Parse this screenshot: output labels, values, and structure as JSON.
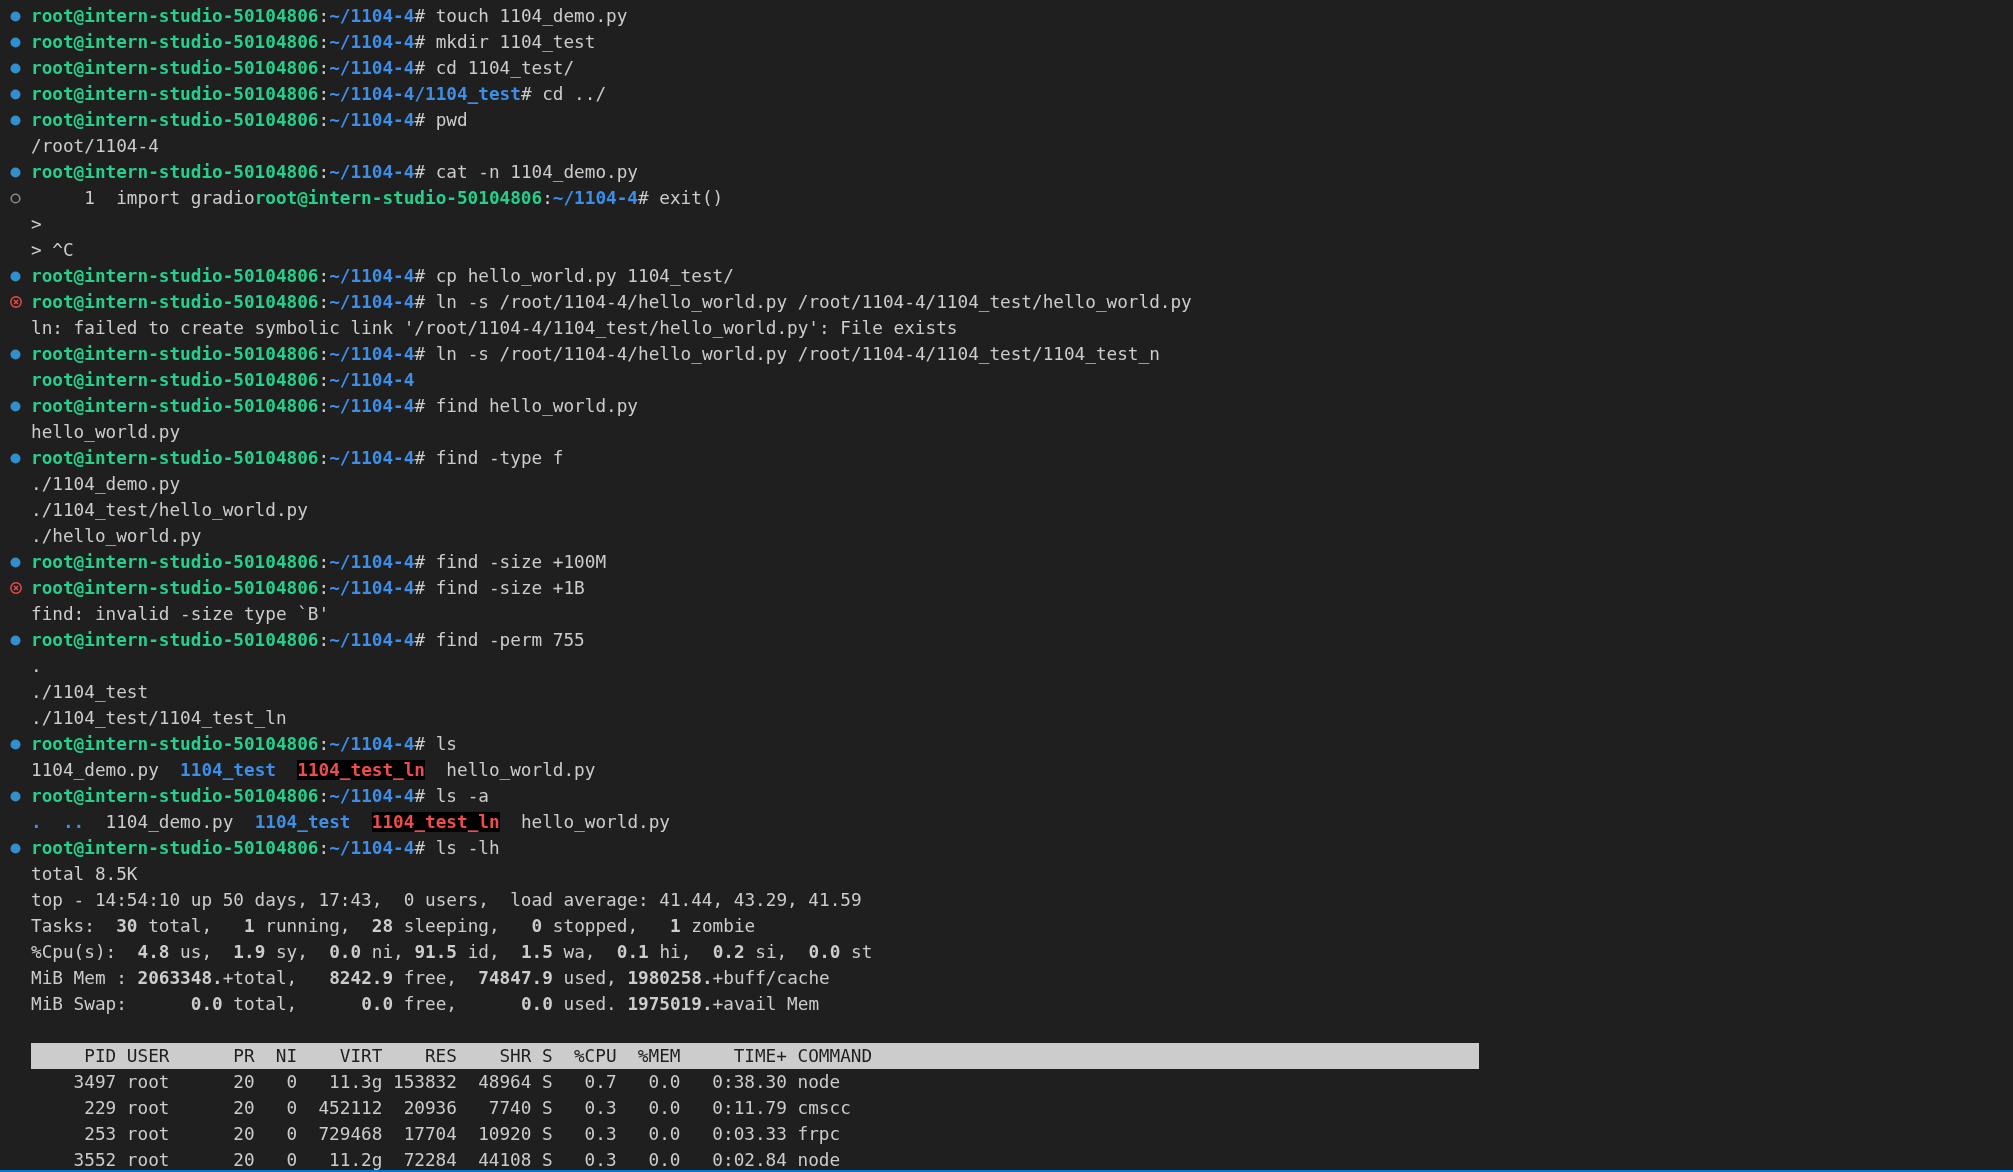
{
  "lines": [
    {
      "kind": "prompt_ok",
      "host": "root@intern-studio-50104806",
      "sep": ":",
      "path": "~/1104-4",
      "command": "# touch 1104_demo.py"
    },
    {
      "kind": "prompt_ok",
      "host": "root@intern-studio-50104806",
      "sep": ":",
      "path": "~/1104-4",
      "command": "# mkdir 1104_test"
    },
    {
      "kind": "prompt_ok",
      "host": "root@intern-studio-50104806",
      "sep": ":",
      "path": "~/1104-4",
      "command": "# cd 1104_test/"
    },
    {
      "kind": "prompt_ok",
      "host": "root@intern-studio-50104806",
      "sep": ":",
      "path": "~/1104-4/1104_test",
      "command": "# cd ../"
    },
    {
      "kind": "prompt_ok",
      "host": "root@intern-studio-50104806",
      "sep": ":",
      "path": "~/1104-4",
      "command": "# pwd"
    },
    {
      "kind": "output",
      "text": "/root/1104-4"
    },
    {
      "kind": "prompt_ok",
      "host": "root@intern-studio-50104806",
      "sep": ":",
      "path": "~/1104-4",
      "command": "# cat -n 1104_demo.py"
    },
    {
      "kind": "prompt_pending",
      "prefix": "     1  import gradio",
      "host": "root@intern-studio-50104806",
      "sep": ":",
      "path": "~/1104-4",
      "command": "# exit()"
    },
    {
      "kind": "output",
      "text": ">"
    },
    {
      "kind": "output",
      "text": "> ^C"
    },
    {
      "kind": "prompt_ok",
      "host": "root@intern-studio-50104806",
      "sep": ":",
      "path": "~/1104-4",
      "command": "# cp hello_world.py 1104_test/"
    },
    {
      "kind": "prompt_error",
      "host": "root@intern-studio-50104806",
      "sep": ":",
      "path": "~/1104-4",
      "command": "# ln -s /root/1104-4/hello_world.py /root/1104-4/1104_test/hello_world.py"
    },
    {
      "kind": "output",
      "text": "ln: failed to create symbolic link '/root/1104-4/1104_test/hello_world.py': File exists"
    },
    {
      "kind": "prompt_ok",
      "host": "root@intern-studio-50104806",
      "sep": ":",
      "path": "~/1104-4",
      "command": "# ln -s /root/1104-4/hello_world.py /root/1104-4/1104_test/1104_test_n"
    },
    {
      "kind": "prompt_plain",
      "host": "root@intern-studio-50104806",
      "sep": ":",
      "path": "~/1104-4"
    },
    {
      "kind": "prompt_ok",
      "host": "root@intern-studio-50104806",
      "sep": ":",
      "path": "~/1104-4",
      "command": "# find hello_world.py"
    },
    {
      "kind": "output",
      "text": "hello_world.py"
    },
    {
      "kind": "prompt_ok",
      "host": "root@intern-studio-50104806",
      "sep": ":",
      "path": "~/1104-4",
      "command": "# find -type f"
    },
    {
      "kind": "output",
      "text": "./1104_demo.py"
    },
    {
      "kind": "output",
      "text": "./1104_test/hello_world.py"
    },
    {
      "kind": "output",
      "text": "./hello_world.py"
    },
    {
      "kind": "prompt_ok",
      "host": "root@intern-studio-50104806",
      "sep": ":",
      "path": "~/1104-4",
      "command": "# find -size +100M"
    },
    {
      "kind": "prompt_error",
      "host": "root@intern-studio-50104806",
      "sep": ":",
      "path": "~/1104-4",
      "command": "# find -size +1B"
    },
    {
      "kind": "output",
      "text": "find: invalid -size type `B'"
    },
    {
      "kind": "prompt_ok",
      "host": "root@intern-studio-50104806",
      "sep": ":",
      "path": "~/1104-4",
      "command": "# find -perm 755"
    },
    {
      "kind": "output",
      "text": "."
    },
    {
      "kind": "output",
      "text": "./1104_test"
    },
    {
      "kind": "output",
      "text": "./1104_test/1104_test_ln"
    },
    {
      "kind": "prompt_ok",
      "host": "root@intern-studio-50104806",
      "sep": ":",
      "path": "~/1104-4",
      "command": "# ls"
    },
    {
      "kind": "listing",
      "entries": [
        {
          "name": "1104_demo.py",
          "kind": "file"
        },
        {
          "name": "1104_test",
          "kind": "dir"
        },
        {
          "name": "1104_test_ln",
          "kind": "link"
        },
        {
          "name": "hello_world.py",
          "kind": "file"
        }
      ]
    },
    {
      "kind": "prompt_ok",
      "host": "root@intern-studio-50104806",
      "sep": ":",
      "path": "~/1104-4",
      "command": "# ls -a"
    },
    {
      "kind": "listing",
      "entries": [
        {
          "name": ".",
          "kind": "dir"
        },
        {
          "name": "..",
          "kind": "dir"
        },
        {
          "name": "1104_demo.py",
          "kind": "file"
        },
        {
          "name": "1104_test",
          "kind": "dir"
        },
        {
          "name": "1104_test_ln",
          "kind": "link"
        },
        {
          "name": "hello_world.py",
          "kind": "file"
        }
      ]
    },
    {
      "kind": "prompt_ok",
      "host": "root@intern-studio-50104806",
      "sep": ":",
      "path": "~/1104-4",
      "command": "# ls -lh"
    },
    {
      "kind": "output",
      "text": "total 8.5K"
    },
    {
      "kind": "output",
      "text": "top - 14:54:10 up 50 days, 17:43,  0 users,  load average: 41.44, 43.29, 41.59"
    },
    {
      "kind": "output",
      "text": "Tasks:  **30** total,   **1** running,  **28** sleeping,   **0** stopped,   **1** zombie"
    },
    {
      "kind": "output",
      "text": "%Cpu(s):  **4.8** us,  **1.9** sy,  **0.0** ni, **91.5** id,  **1.5** wa,  **0.1** hi,  **0.2** si,  **0.0** st"
    },
    {
      "kind": "output",
      "text": "MiB Mem : **2063348.**+total,   **8242.9** free,  **74847.9** used, **1980258.**+buff/cache"
    },
    {
      "kind": "output",
      "text": "MiB Swap:      **0.0** total,      **0.0** free,      **0.0** used. **1975019.**+avail Mem"
    },
    {
      "kind": "blank"
    }
  ],
  "process_table": {
    "columns": [
      "PID",
      "USER",
      "PR",
      "NI",
      "VIRT",
      "RES",
      "SHR",
      "S",
      "%CPU",
      "%MEM",
      "TIME+",
      "COMMAND"
    ],
    "rows": [
      [
        "3497",
        "root",
        "20",
        "0",
        "11.3g",
        "153832",
        "48964",
        "S",
        "0.7",
        "0.0",
        "0:38.30",
        "node"
      ],
      [
        "229",
        "root",
        "20",
        "0",
        "452112",
        "20936",
        "7740",
        "S",
        "0.3",
        "0.0",
        "0:11.79",
        "cmscc"
      ],
      [
        "253",
        "root",
        "20",
        "0",
        "729468",
        "17704",
        "10920",
        "S",
        "0.3",
        "0.0",
        "0:03.33",
        "frpc"
      ],
      [
        "3552",
        "root",
        "20",
        "0",
        "11.2g",
        "72284",
        "44108",
        "S",
        "0.3",
        "0.0",
        "0:02.84",
        "node"
      ]
    ]
  }
}
